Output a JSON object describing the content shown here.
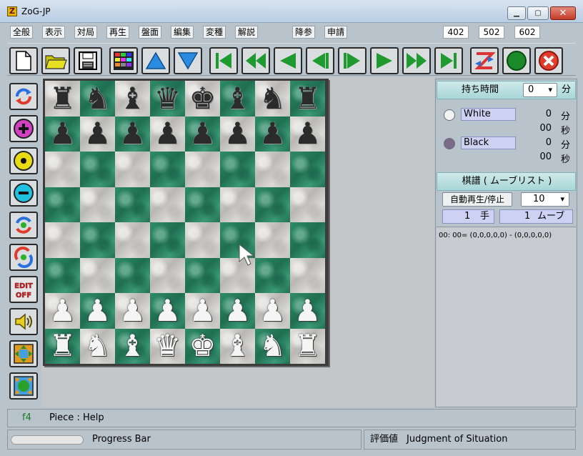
{
  "window": {
    "title": "ZoG-JP",
    "icon_glyph": "Z"
  },
  "menu": {
    "items": [
      "全般",
      "表示",
      "対局",
      "再生",
      "盤面",
      "編集",
      "変種",
      "解説",
      "降参",
      "申請"
    ],
    "numbers": [
      "402",
      "502",
      "602"
    ]
  },
  "toolbar": {
    "buttons": [
      "new-document",
      "open-folder",
      "save-disk",
      "board-palette",
      "arrow-up",
      "arrow-down",
      "go-first",
      "step-back-fast",
      "step-back",
      "undo-move",
      "redo-move",
      "step-forward",
      "step-forward-fast",
      "go-last",
      "swap-sides",
      "green-circle",
      "close-x"
    ]
  },
  "left_tools": {
    "edit_off_label": "EDIT OFF",
    "buttons": [
      "rotate-board",
      "add-piece",
      "center-mark",
      "remove-piece",
      "recycle",
      "recycle-alt",
      "edit-off",
      "sound",
      "expand-board",
      "shrink-board"
    ]
  },
  "board": {
    "rows": [
      [
        "r",
        "n",
        "b",
        "q",
        "k",
        "b",
        "n",
        "r"
      ],
      [
        "p",
        "p",
        "p",
        "p",
        "p",
        "p",
        "p",
        "p"
      ],
      [
        "",
        "",
        "",
        "",
        "",
        "",
        "",
        ""
      ],
      [
        "",
        "",
        "",
        "",
        "",
        "",
        "",
        ""
      ],
      [
        "",
        "",
        "",
        "",
        "",
        "",
        "",
        ""
      ],
      [
        "",
        "",
        "",
        "",
        "",
        "",
        "",
        ""
      ],
      [
        "P",
        "P",
        "P",
        "P",
        "P",
        "P",
        "P",
        "P"
      ],
      [
        "R",
        "N",
        "B",
        "Q",
        "K",
        "B",
        "N",
        "R"
      ]
    ]
  },
  "clock": {
    "header_label": "持ち時間",
    "minutes_select": "0",
    "minutes_unit": "分",
    "white": {
      "name": "White",
      "min": "0",
      "sec": "00",
      "radio_color": "#f2f2f2"
    },
    "black": {
      "name": "Black",
      "min": "0",
      "sec": "00",
      "radio_color": "#7a6a8a"
    },
    "min_unit": "分",
    "sec_unit": "秒"
  },
  "movelist": {
    "header_label": "棋譜 ( ムーブリスト )",
    "auto_play_label": "自動再生/停止",
    "speed_select": "10",
    "move_count": "1",
    "move_unit": "手",
    "move_index": "1",
    "move_index_unit": "ムーブ",
    "entries": [
      "00: 00= (0,0,0,0,0) - (0,0,0,0,0)"
    ]
  },
  "status": {
    "key": "f4",
    "help": "Piece : Help",
    "progress_label": "Progress Bar",
    "progress": 0,
    "eval_title": "評価値",
    "eval_text": "Judgment of Situation"
  },
  "colors": {
    "accent": "#2e8c69",
    "panel_head": "#a8d6d8"
  }
}
